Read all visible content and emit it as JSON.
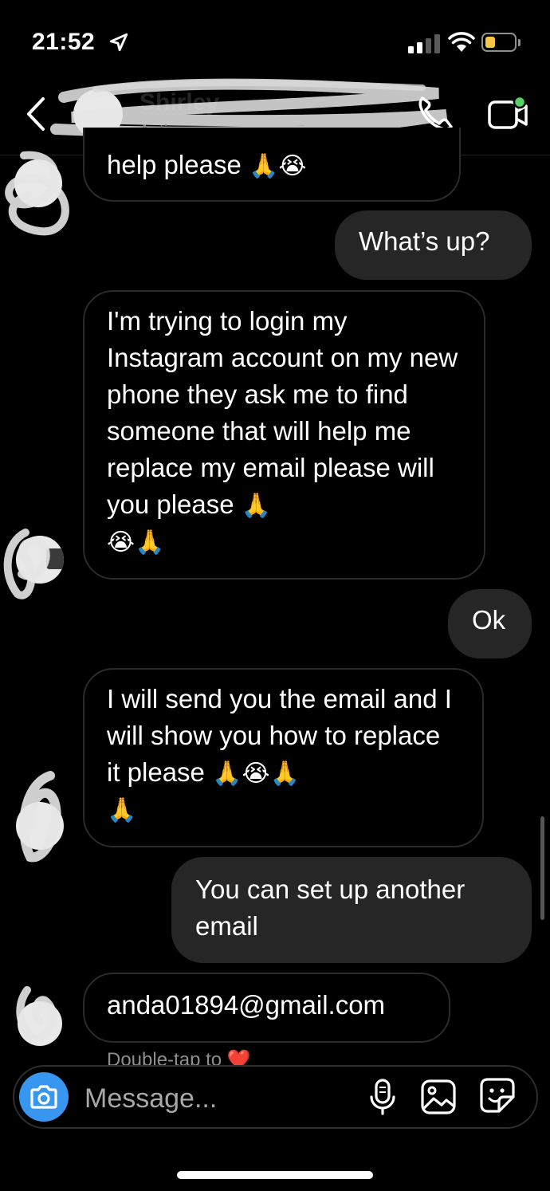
{
  "status_bar": {
    "time": "21:52",
    "battery_color": "#f6c644"
  },
  "header": {
    "contact_name": "Shirley",
    "active_status": "Active now",
    "back_icon": "chevron-left-icon",
    "call_icon": "phone-icon",
    "video_icon": "video-camera-icon"
  },
  "messages": [
    {
      "side": "received",
      "text": "help please",
      "emoji": "🙏😭"
    },
    {
      "side": "sent",
      "text": "What’s up?"
    },
    {
      "side": "received",
      "text": "I'm trying to login my Instagram account on my new phone they ask me to find someone that will help me replace my email please will you please",
      "emoji_after": "🙏",
      "emoji_line": "😭🙏"
    },
    {
      "side": "sent",
      "text": "Ok"
    },
    {
      "side": "received",
      "text": "I will send you the email and I will show you how to replace it please",
      "emoji_after": "🙏😭🙏",
      "emoji_line": "🙏"
    },
    {
      "side": "sent",
      "text": "You can set up another email"
    },
    {
      "side": "received",
      "text": "anda01894@gmail.com"
    }
  ],
  "hint": {
    "text": "Double-tap to",
    "heart": "❤️"
  },
  "composer": {
    "placeholder": "Message...",
    "camera_icon": "camera-icon",
    "mic_icon": "microphone-icon",
    "gallery_icon": "gallery-icon",
    "sticker_icon": "sticker-icon"
  },
  "colors": {
    "background": "#000000",
    "sent_bubble": "#262626",
    "received_border": "#2b2b2b",
    "accent": "#3797f0",
    "online_dot": "#57d163"
  }
}
